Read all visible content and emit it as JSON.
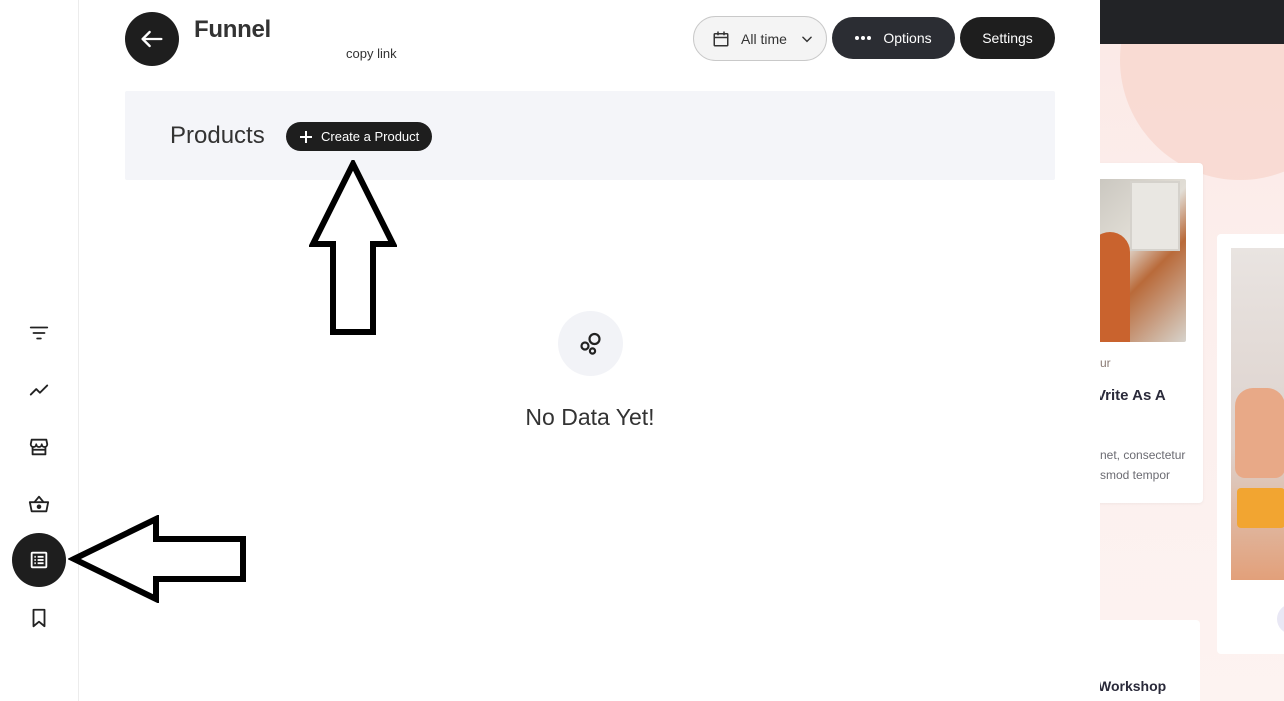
{
  "header": {
    "title": "Funnel",
    "copy_link": "copy link",
    "date_filter": "All time",
    "options_label": "Options",
    "settings_label": "Settings"
  },
  "products": {
    "title": "Products",
    "create_label": "Create a Product"
  },
  "empty_state": {
    "message": "No Data Yet!"
  },
  "sidebar": {
    "items": [
      {
        "icon": "filter-icon"
      },
      {
        "icon": "trend-icon"
      },
      {
        "icon": "store-icon"
      },
      {
        "icon": "basket-icon"
      },
      {
        "icon": "list-icon",
        "active": true
      },
      {
        "icon": "bookmark-icon"
      }
    ]
  },
  "preview": {
    "card1_meta": "ur",
    "card1_heading": "Vrite As A",
    "card1_text": "net, consectetur smod tempor",
    "card3_title": "Workshop"
  },
  "colors": {
    "dark": "#1e1e1e",
    "options_bg": "#2b2d33",
    "bar_bg": "#f4f5f9",
    "preview_bg": "#fbe9e6"
  }
}
